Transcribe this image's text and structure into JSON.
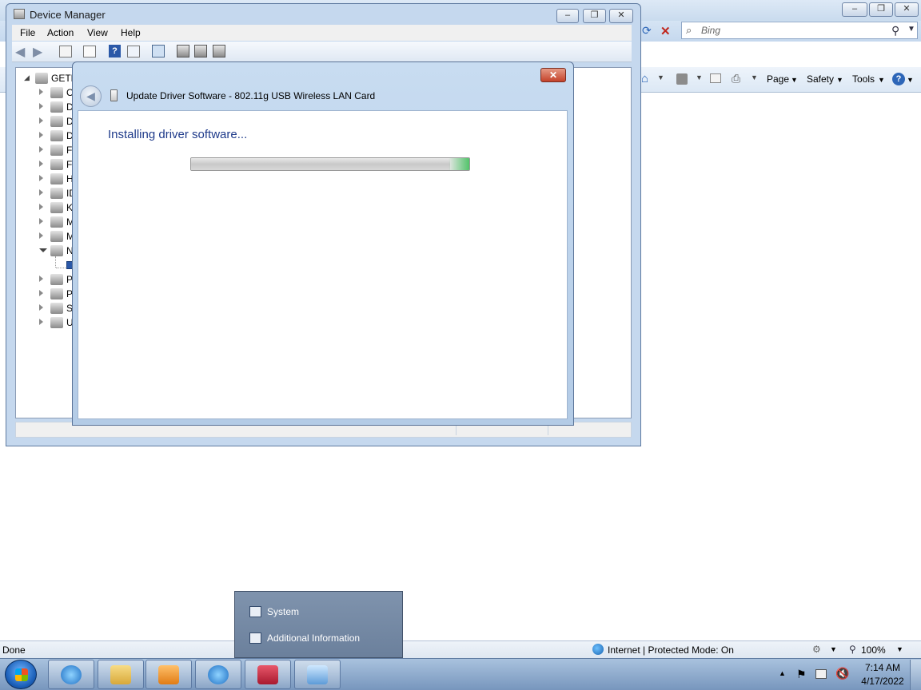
{
  "ie": {
    "search_placeholder": "Bing",
    "cmd_page": "Page",
    "cmd_safety": "Safety",
    "cmd_tools": "Tools",
    "status_done": "Done",
    "status_zone": "Internet | Protected Mode: On",
    "zoom": "100%"
  },
  "device_manager": {
    "title": "Device Manager",
    "menu": [
      "File",
      "Action",
      "View",
      "Help"
    ],
    "tree_root": "GETR",
    "tree_items": [
      "C",
      "D",
      "D",
      "D",
      "F",
      "F",
      "H",
      "ID",
      "K",
      "M",
      "M",
      "N",
      "",
      "P",
      "P",
      "S",
      "U"
    ]
  },
  "driver_dialog": {
    "title": "Update Driver Software - 802.11g USB Wireless LAN Card",
    "heading": "Installing driver software...",
    "progress": 0.93
  },
  "jump_list": {
    "items": [
      "System",
      "Additional Information"
    ]
  },
  "taskbar": {
    "time": "7:14 AM",
    "date": "4/17/2022"
  },
  "colors": {
    "heading_blue": "#1e3a8a",
    "progress_green": "#52c46a",
    "taskbar": "#8aa8cf"
  }
}
